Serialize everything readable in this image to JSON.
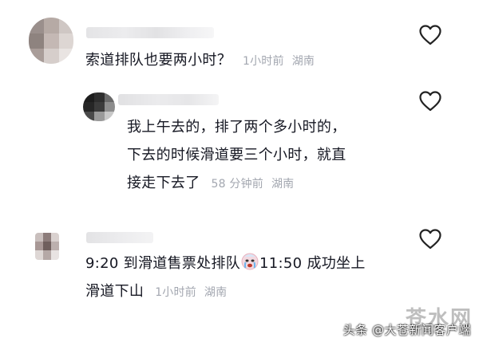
{
  "comments": [
    {
      "text_lines": [
        "索道排队也要两小时？"
      ],
      "time": "1小时前",
      "location": "湖南"
    },
    {
      "text_lines": [
        "我上午去的，排了两个多小时的，",
        "下去的时候滑道要三个小时，就直",
        "接走下去了"
      ],
      "time": "58 分钟前",
      "location": "湖南"
    },
    {
      "text_lines": [
        "9:20 到滑道售票处排队",
        "11:50 成功坐上",
        "滑道下山"
      ],
      "time": "1小时前",
      "location": "湖南"
    }
  ],
  "icons": {
    "like": "heart-outline-icon",
    "emoji": "crying-face-emoji"
  },
  "watermark": {
    "brand": "苍水网",
    "source": "头条 @大苍新闻客户端"
  },
  "colors": {
    "text": "#161823",
    "meta": "#a3a7b0",
    "background": "#ffffff"
  }
}
